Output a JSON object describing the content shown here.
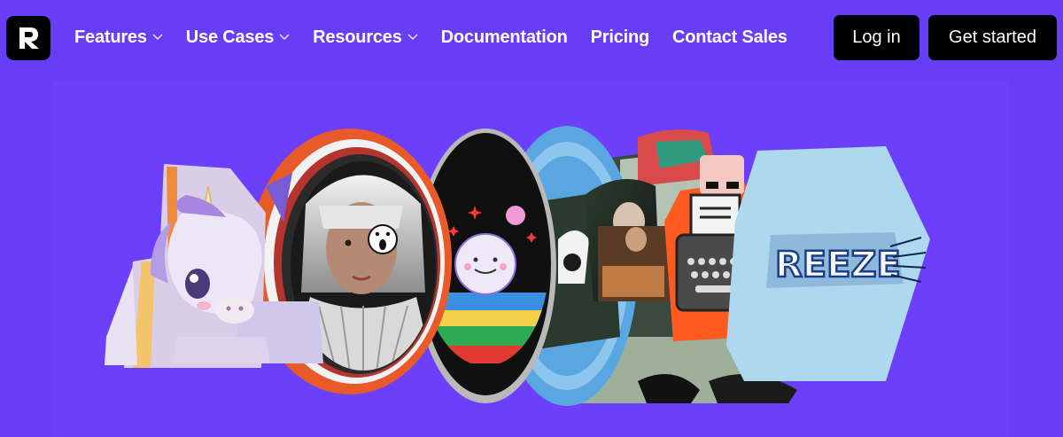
{
  "nav": {
    "items": [
      {
        "label": "Features",
        "has_dropdown": true
      },
      {
        "label": "Use Cases",
        "has_dropdown": true
      },
      {
        "label": "Resources",
        "has_dropdown": true
      },
      {
        "label": "Documentation",
        "has_dropdown": false
      },
      {
        "label": "Pricing",
        "has_dropdown": false
      },
      {
        "label": "Contact Sales",
        "has_dropdown": false
      }
    ]
  },
  "auth": {
    "login_label": "Log in",
    "get_started_label": "Get started"
  },
  "hero": {
    "art_text": "REEZE"
  },
  "colors": {
    "background": "#673df6",
    "button": "#000000",
    "text": "#ffffff"
  },
  "icons": {
    "logo": "brand-logo-icon",
    "chevron": "chevron-down-icon",
    "badge": "surprised-face-icon",
    "typewriter": "typewriter-icon"
  }
}
